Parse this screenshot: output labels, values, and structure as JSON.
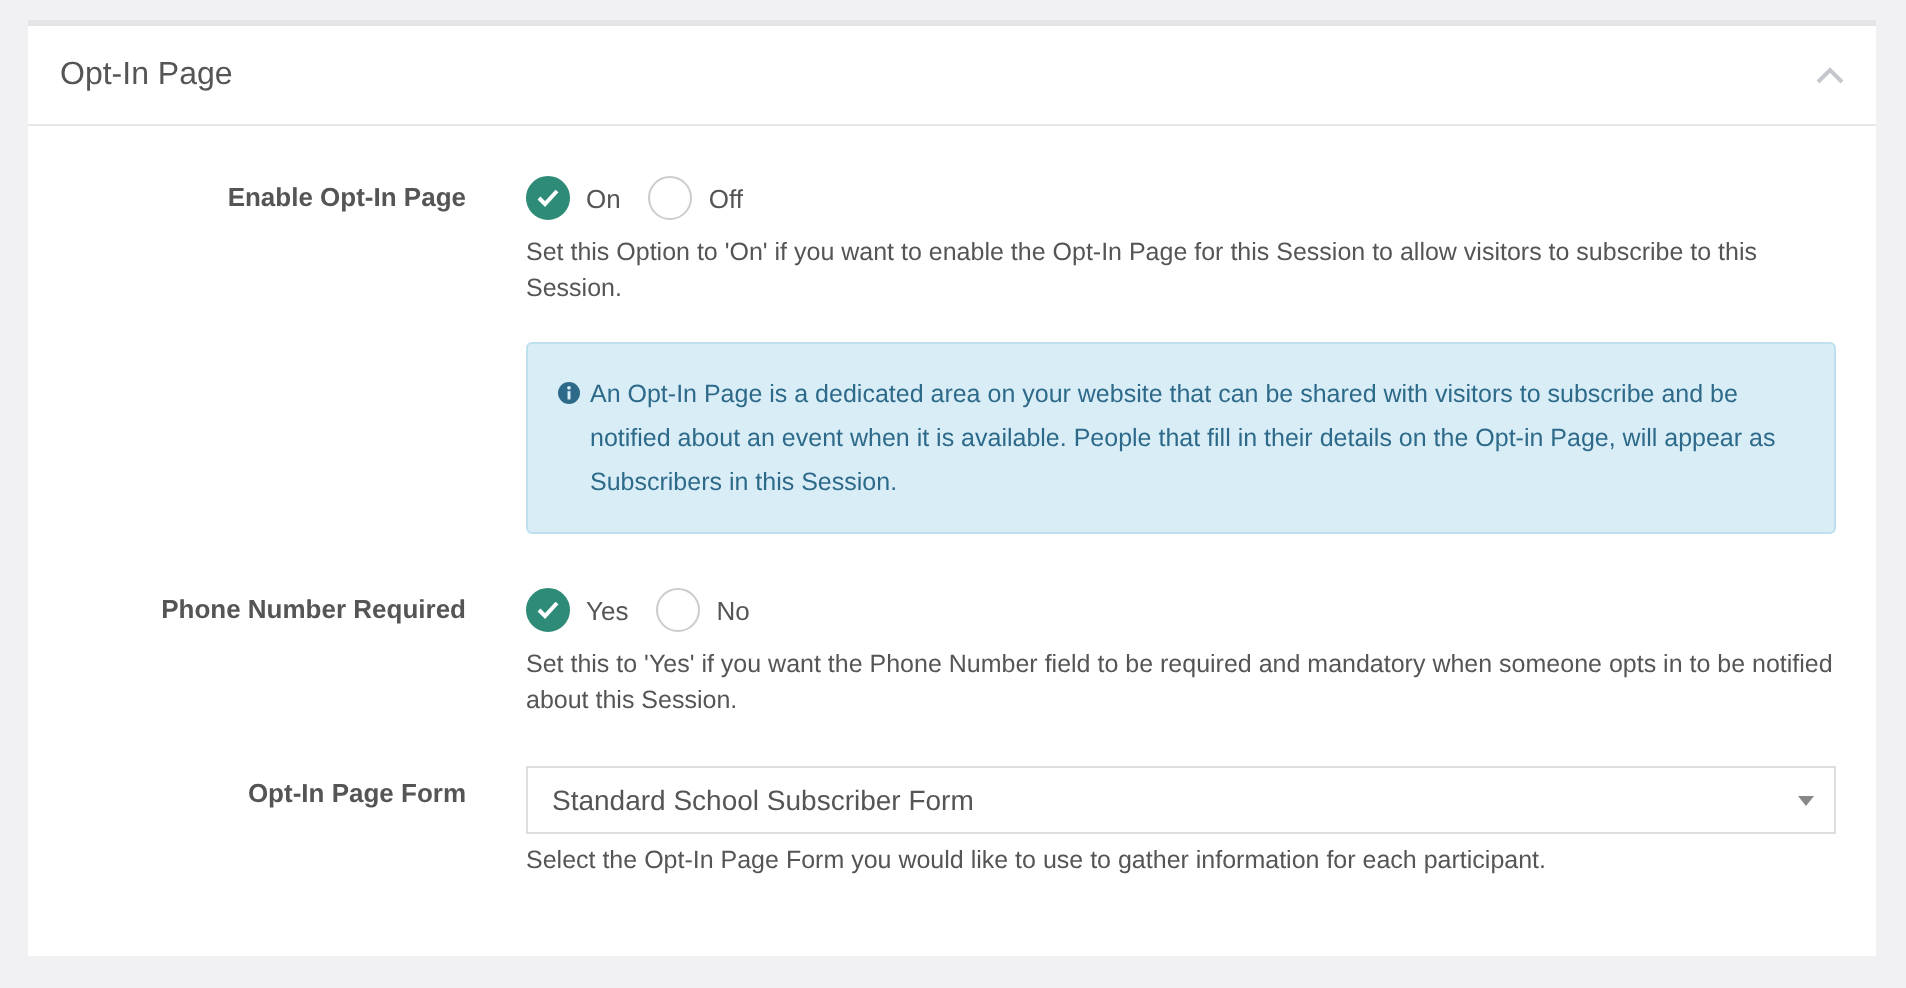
{
  "panel": {
    "title": "Opt-In Page",
    "expanded": true
  },
  "fields": [
    {
      "kind": "radio",
      "label": "Enable Opt-In Page",
      "options": [
        {
          "label": "On",
          "selected": true
        },
        {
          "label": "Off",
          "selected": false
        }
      ],
      "help": "Set this Option to 'On' if you want to enable the Opt-In Page for this Session to allow visitors to subscribe to this Session.",
      "note": "An Opt-In Page is a dedicated area on your website that can be shared with visitors to subscribe and be notified about an event when it is available. People that fill in their details on the Opt-in Page, will appear as Subscribers in this Session."
    },
    {
      "kind": "radio",
      "label": "Phone Number Required",
      "options": [
        {
          "label": "Yes",
          "selected": true
        },
        {
          "label": "No",
          "selected": false
        }
      ],
      "help": "Set this to 'Yes' if you want the Phone Number field to be required and mandatory when someone opts in to be notified about this Session."
    },
    {
      "kind": "select",
      "label": "Opt-In Page Form",
      "value": "Standard School Subscriber Form",
      "help": "Select the Opt-In Page Form you would like to use to gather information for each participant."
    }
  ]
}
